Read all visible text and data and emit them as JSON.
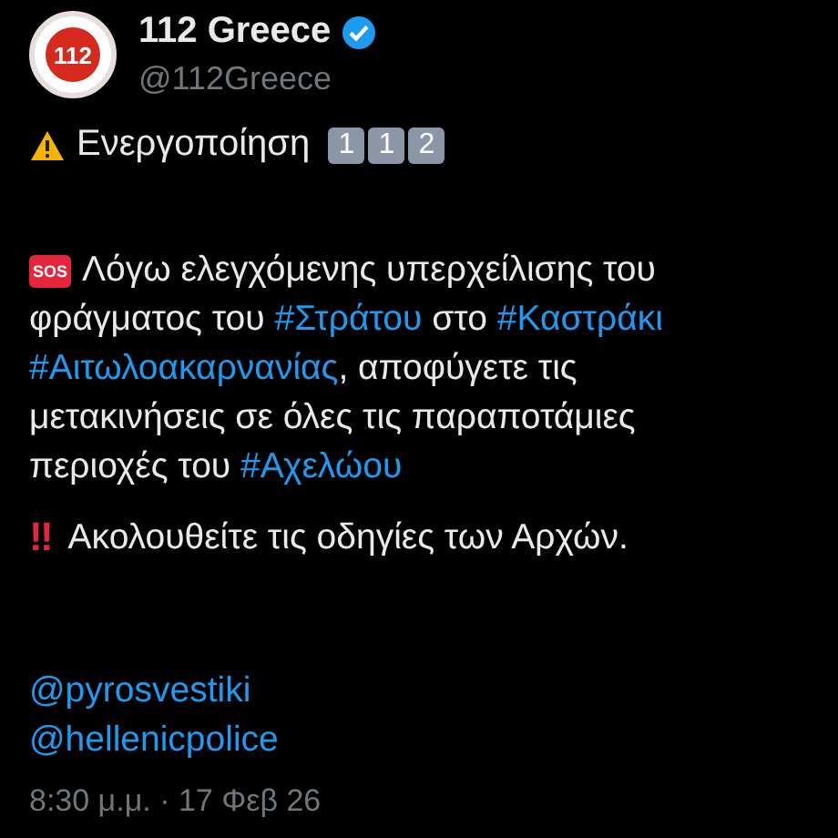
{
  "author": {
    "name": "112 Greece",
    "verified": true,
    "handle": "@112Greece",
    "avatar_text": "112"
  },
  "headline": {
    "text": "Ενεργοποίηση",
    "keycaps": [
      "1",
      "1",
      "2"
    ]
  },
  "alert": {
    "badge": "SOS",
    "parts": [
      {
        "kind": "text",
        "text": "Λόγω ελεγχόμενης υπερχείλισης του φράγματος του "
      },
      {
        "kind": "hashtag",
        "text": "#Στράτου"
      },
      {
        "kind": "text",
        "text": " στο "
      },
      {
        "kind": "hashtag",
        "text": "#Καστράκι"
      },
      {
        "kind": "hashtag",
        "text": "#Αιτωλοακαρνανίας"
      },
      {
        "kind": "text",
        "text": ", αποφύγετε τις μετακινήσεις σε όλες τις παραποτάμιες περιοχές του "
      },
      {
        "kind": "hashtag",
        "text": "#Αχελώου"
      }
    ]
  },
  "notice": {
    "mark": "‼",
    "text": "Ακολουθείτε τις οδηγίες των Αρχών."
  },
  "mentions": [
    "@pyrosvestiki",
    "@hellenicpolice"
  ],
  "timestamp": "8:30 μ.μ. · 17 Φεβ 26"
}
